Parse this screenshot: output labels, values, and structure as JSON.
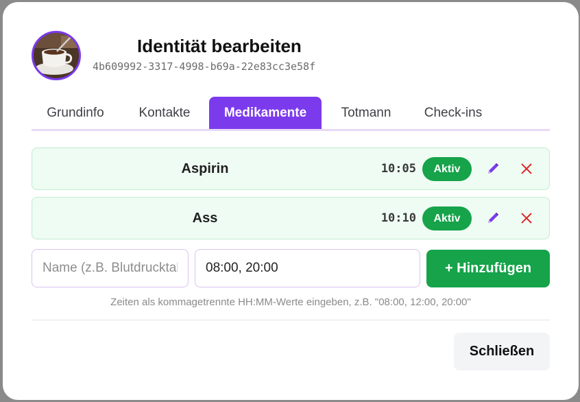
{
  "dialog": {
    "title": "Identität bearbeiten",
    "identity_id": "4b609992-3317-4998-b69a-22e83cc3e58f"
  },
  "tabs": [
    {
      "label": "Grundinfo",
      "active": false
    },
    {
      "label": "Kontakte",
      "active": false
    },
    {
      "label": "Medikamente",
      "active": true
    },
    {
      "label": "Totmann",
      "active": false
    },
    {
      "label": "Check-ins",
      "active": false
    }
  ],
  "medications": [
    {
      "name": "Aspirin",
      "time": "10:05",
      "status": "Aktiv"
    },
    {
      "name": "Ass",
      "time": "10:10",
      "status": "Aktiv"
    }
  ],
  "form": {
    "name_placeholder": "Name (z.B. Blutdrucktabletten)",
    "name_value": "",
    "times_value": "08:00, 20:00",
    "add_label": "+ Hinzufügen",
    "hint": "Zeiten als kommagetrennte HH:MM-Werte eingeben, z.B. \"08:00, 12:00, 20:00\""
  },
  "footer": {
    "close_label": "Schließen"
  },
  "icons": {
    "avatar": "coffee-cup-photo",
    "edit": "pencil-icon",
    "delete": "close-icon"
  },
  "colors": {
    "accent": "#7c3aed",
    "success": "#16a34a",
    "row_bg": "#effcf3",
    "delete": "#dc2626"
  }
}
